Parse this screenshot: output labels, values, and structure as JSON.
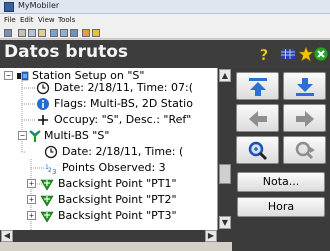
{
  "window": {
    "title": "MyMobiler"
  },
  "menu": {
    "items": [
      "File",
      "Edit",
      "View",
      "Tools"
    ]
  },
  "header": {
    "title": "Datos brutos"
  },
  "tree": {
    "rows": [
      {
        "expander": "−",
        "icon": "station-icon",
        "text": "Station Setup on \"S\""
      },
      {
        "expander": "",
        "icon": "clock-icon",
        "text": "Date: 2/18/11, Time: 07:("
      },
      {
        "expander": "",
        "icon": "info-icon",
        "text": "Flags: Multi-BS, 2D Statio"
      },
      {
        "expander": "",
        "icon": "plus-icon",
        "text": "Occupy: \"S\", Desc.: \"Ref\""
      },
      {
        "expander": "−",
        "icon": "antenna-icon",
        "text": "Multi-BS \"S\""
      },
      {
        "expander": "",
        "icon": "clock-icon",
        "text": "Date: 2/18/11, Time: ("
      },
      {
        "expander": "",
        "icon": "number-icon",
        "text": "Points Observed: 3"
      },
      {
        "expander": "+",
        "icon": "backsight-icon",
        "text": "Backsight Point \"PT1\""
      },
      {
        "expander": "+",
        "icon": "backsight-icon",
        "text": "Backsight Point \"PT2\""
      },
      {
        "expander": "+",
        "icon": "backsight-icon",
        "text": "Backsight Point \"PT3\""
      }
    ]
  },
  "side_buttons": {
    "nota_label": "Nota...",
    "hora_label": "Hora"
  },
  "colors": {
    "header_bg": "#3d3d3d",
    "tree_blue": "#1f6fd1",
    "tree_green": "#1e9a2a",
    "nav_blue": "#2a6fd6",
    "arrow_gray": "#8e8e8e"
  }
}
